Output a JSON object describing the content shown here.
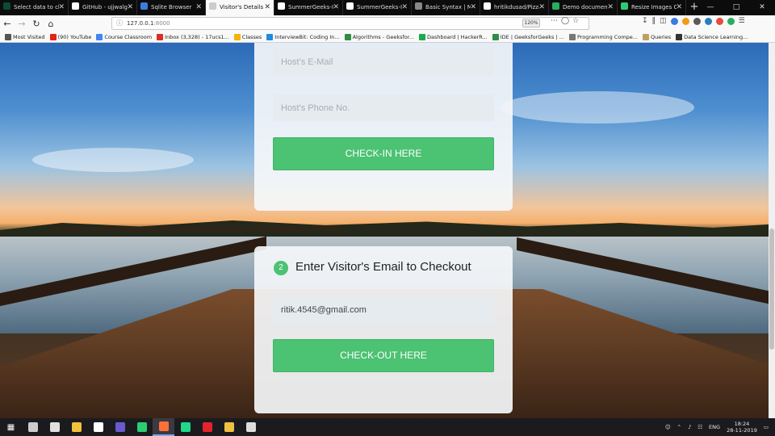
{
  "browser": {
    "tabs": [
      {
        "title": "Select data to change",
        "favicon_color": "#0c4b33"
      },
      {
        "title": "GitHub - ujjwalg",
        "favicon_color": "#ffffff"
      },
      {
        "title": "Sqlite Browser",
        "favicon_color": "#3b7ddd"
      },
      {
        "title": "Visitor's Details",
        "favicon_color": "#cccccc",
        "active": true
      },
      {
        "title": "SummerGeeks-In",
        "favicon_color": "#ffffff"
      },
      {
        "title": "SummerGeeks-In",
        "favicon_color": "#ffffff"
      },
      {
        "title": "Basic Syntax | Ma",
        "favicon_color": "#888888"
      },
      {
        "title": "hritikdusad/Pizza",
        "favicon_color": "#ffffff"
      },
      {
        "title": "Demo document",
        "favicon_color": "#27ae60"
      },
      {
        "title": "Resize Images Or",
        "favicon_color": "#2ecc71"
      }
    ],
    "new_tab_label": "+",
    "url": {
      "host": "127.0.0.1",
      "port": ":8000"
    },
    "zoom": "120%",
    "bookmarks": [
      {
        "label": "Most Visited",
        "color": "#555555"
      },
      {
        "label": "(90) YouTube",
        "color": "#e62117"
      },
      {
        "label": "Course Classroom",
        "color": "#4285f4"
      },
      {
        "label": "Inbox (3,328) - 17ucs1...",
        "color": "#d93025"
      },
      {
        "label": "Classes",
        "color": "#f4b400"
      },
      {
        "label": "InterviewBit: Coding In...",
        "color": "#1c8de0"
      },
      {
        "label": "Algorithms - Geeksfor...",
        "color": "#2f8d46"
      },
      {
        "label": "Dashboard | HackerR...",
        "color": "#1ba94c"
      },
      {
        "label": "IDE | GeeksforGeeks | ...",
        "color": "#2f8d46"
      },
      {
        "label": "Programming Compe...",
        "color": "#777777"
      },
      {
        "label": "Queries",
        "color": "#c0a060"
      },
      {
        "label": "Data Science Learning...",
        "color": "#333333"
      }
    ]
  },
  "checkin_form": {
    "host_email_placeholder": "Host's E-Mail",
    "host_phone_placeholder": "Host's Phone No.",
    "checkin_button": "CHECK-IN HERE"
  },
  "checkout_form": {
    "step_number": "2",
    "title": "Enter Visitor's Email to Checkout",
    "email_value": "ritik.4545@gmail.com",
    "checkout_button": "CHECK-OUT HERE"
  },
  "taskbar": {
    "time": "18:24",
    "date": "28-11-2019",
    "language": "ENG",
    "apps": [
      {
        "name": "task-view",
        "color": "#cccccc"
      },
      {
        "name": "mail",
        "color": "#e0e0e0"
      },
      {
        "name": "file-explorer",
        "color": "#f3c13a"
      },
      {
        "name": "store",
        "color": "#ffffff"
      },
      {
        "name": "app-generic",
        "color": "#6a5acd"
      },
      {
        "name": "app-circle",
        "color": "#2ecc71"
      },
      {
        "name": "firefox",
        "color": "#ff7139",
        "active": true
      },
      {
        "name": "pycharm",
        "color": "#21d789"
      },
      {
        "name": "acrobat",
        "color": "#e3242b"
      },
      {
        "name": "git",
        "color": "#f0c040"
      },
      {
        "name": "photos",
        "color": "#dddddd"
      }
    ]
  },
  "colors": {
    "accent_green": "#4cc273",
    "field_bg": "#e6ebf0",
    "card_bg": "#f5f7fa"
  }
}
